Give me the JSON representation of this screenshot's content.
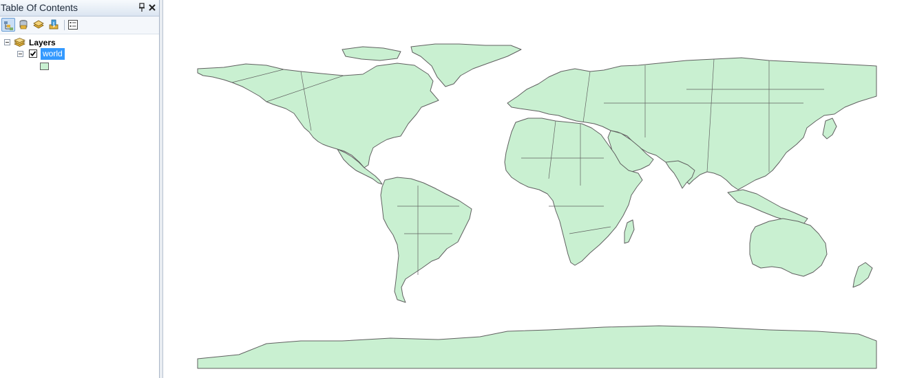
{
  "toc": {
    "title": "Table Of Contents",
    "pin_icon": "pin-icon",
    "close_icon": "close-icon",
    "toolbar": [
      {
        "name": "list-by-drawing-order",
        "icon": "drawing-order-icon",
        "active": true
      },
      {
        "name": "list-by-source",
        "icon": "database-icon",
        "active": false
      },
      {
        "name": "list-by-visibility",
        "icon": "visibility-layers-icon",
        "active": false
      },
      {
        "name": "list-by-selection",
        "icon": "selection-icon",
        "active": false
      },
      {
        "name": "options",
        "icon": "options-list-icon",
        "active": false
      }
    ],
    "layers_label": "Layers",
    "layer": {
      "name": "world",
      "checked": true,
      "symbol_color": "#c9f0d1"
    }
  },
  "map": {
    "land_color": "#c9f0d1",
    "outline_color": "#5f5f5f",
    "background": "#ffffff"
  }
}
